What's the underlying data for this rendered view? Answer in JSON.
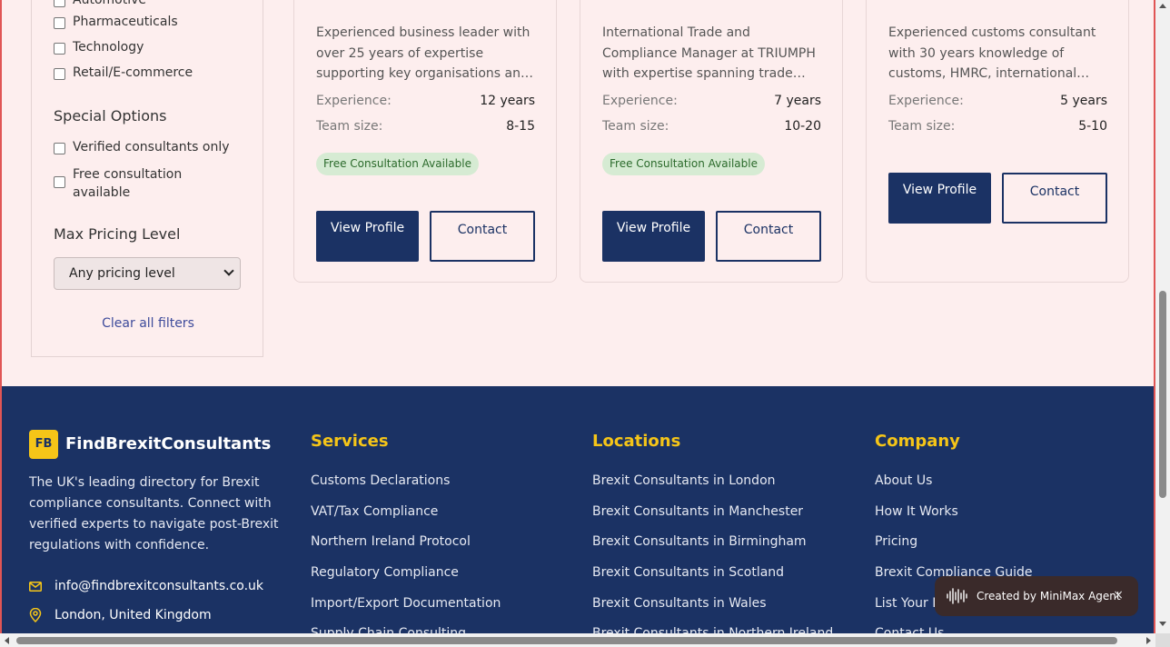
{
  "sidebar": {
    "industries": [
      "Automotive",
      "Pharmaceuticals",
      "Technology",
      "Retail/E-commerce"
    ],
    "special_heading": "Special Options",
    "special_options": [
      "Verified consultants only",
      "Free consultation available"
    ],
    "pricing_heading": "Max Pricing Level",
    "pricing_value": "Any pricing level",
    "clear_label": "Clear all filters"
  },
  "cards": [
    {
      "desc": "Experienced business leader with over 25 years of expertise supporting key organisations an…",
      "experience_label": "Experience:",
      "experience": "12 years",
      "team_label": "Team size:",
      "team": "8-15",
      "badge": "Free Consultation Available",
      "view_label": "View Profile",
      "contact_label": "Contact"
    },
    {
      "desc": "International Trade and Compliance Manager at TRIUMPH with expertise spanning trade…",
      "experience_label": "Experience:",
      "experience": "7 years",
      "team_label": "Team size:",
      "team": "10-20",
      "badge": "Free Consultation Available",
      "view_label": "View Profile",
      "contact_label": "Contact"
    },
    {
      "desc": "Experienced customs consultant with 30 years knowledge of customs, HMRC, international…",
      "experience_label": "Experience:",
      "experience": "5 years",
      "team_label": "Team size:",
      "team": "5-10",
      "view_label": "View Profile",
      "contact_label": "Contact"
    }
  ],
  "footer": {
    "logo_text": "FB",
    "brand": "FindBrexitConsultants",
    "about": "The UK's leading directory for Brexit compliance consultants. Connect with verified experts to navigate post-Brexit regulations with confidence.",
    "email": "info@findbrexitconsultants.co.uk",
    "location": "London, United Kingdom",
    "services": {
      "heading": "Services",
      "links": [
        "Customs Declarations",
        "VAT/Tax Compliance",
        "Northern Ireland Protocol",
        "Regulatory Compliance",
        "Import/Export Documentation",
        "Supply Chain Consulting"
      ]
    },
    "locations": {
      "heading": "Locations",
      "links": [
        "Brexit Consultants in London",
        "Brexit Consultants in Manchester",
        "Brexit Consultants in Birmingham",
        "Brexit Consultants in Scotland",
        "Brexit Consultants in Wales",
        "Brexit Consultants in Northern Ireland"
      ]
    },
    "company": {
      "heading": "Company",
      "links": [
        "About Us",
        "How It Works",
        "Pricing",
        "Brexit Compliance Guide",
        "List Your Business",
        "Contact Us"
      ]
    }
  },
  "toast": {
    "label": "Created by MiniMax Agent",
    "close": "×"
  },
  "colors": {
    "navy": "#1b3264",
    "accent_yellow": "#f5c518",
    "page_bg": "#fdeeee",
    "badge_green_bg": "#d6ebd3"
  }
}
